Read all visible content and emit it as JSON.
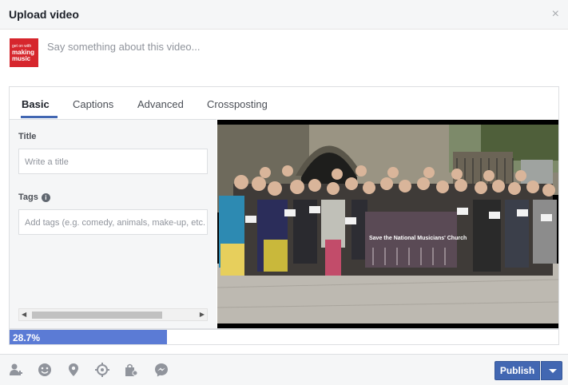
{
  "dialog": {
    "title": "Upload video",
    "close_glyph": "×"
  },
  "composer": {
    "logo_text": [
      "get on with",
      "making",
      "music"
    ],
    "prompt_placeholder": "Say something about this video..."
  },
  "tabs": [
    {
      "label": "Basic",
      "active": true
    },
    {
      "label": "Captions",
      "active": false
    },
    {
      "label": "Advanced",
      "active": false
    },
    {
      "label": "Crossposting",
      "active": false
    }
  ],
  "form": {
    "title_label": "Title",
    "title_placeholder": "Write a title",
    "tags_label": "Tags",
    "tags_placeholder": "Add tags (e.g. comedy, animals, make-up, etc."
  },
  "video": {
    "banner_text": "Save the National Musicians' Church"
  },
  "upload": {
    "progress": 0.287,
    "progress_label": "28.7%"
  },
  "footer": {
    "icons": [
      "tag-people-icon",
      "feeling-icon",
      "location-icon",
      "target-icon",
      "shopping-icon",
      "messenger-icon"
    ],
    "publish_label": "Publish"
  },
  "colors": {
    "accent": "#4267b2",
    "progress_fill": "#5b7bd5",
    "logo_red": "#d6262d"
  }
}
